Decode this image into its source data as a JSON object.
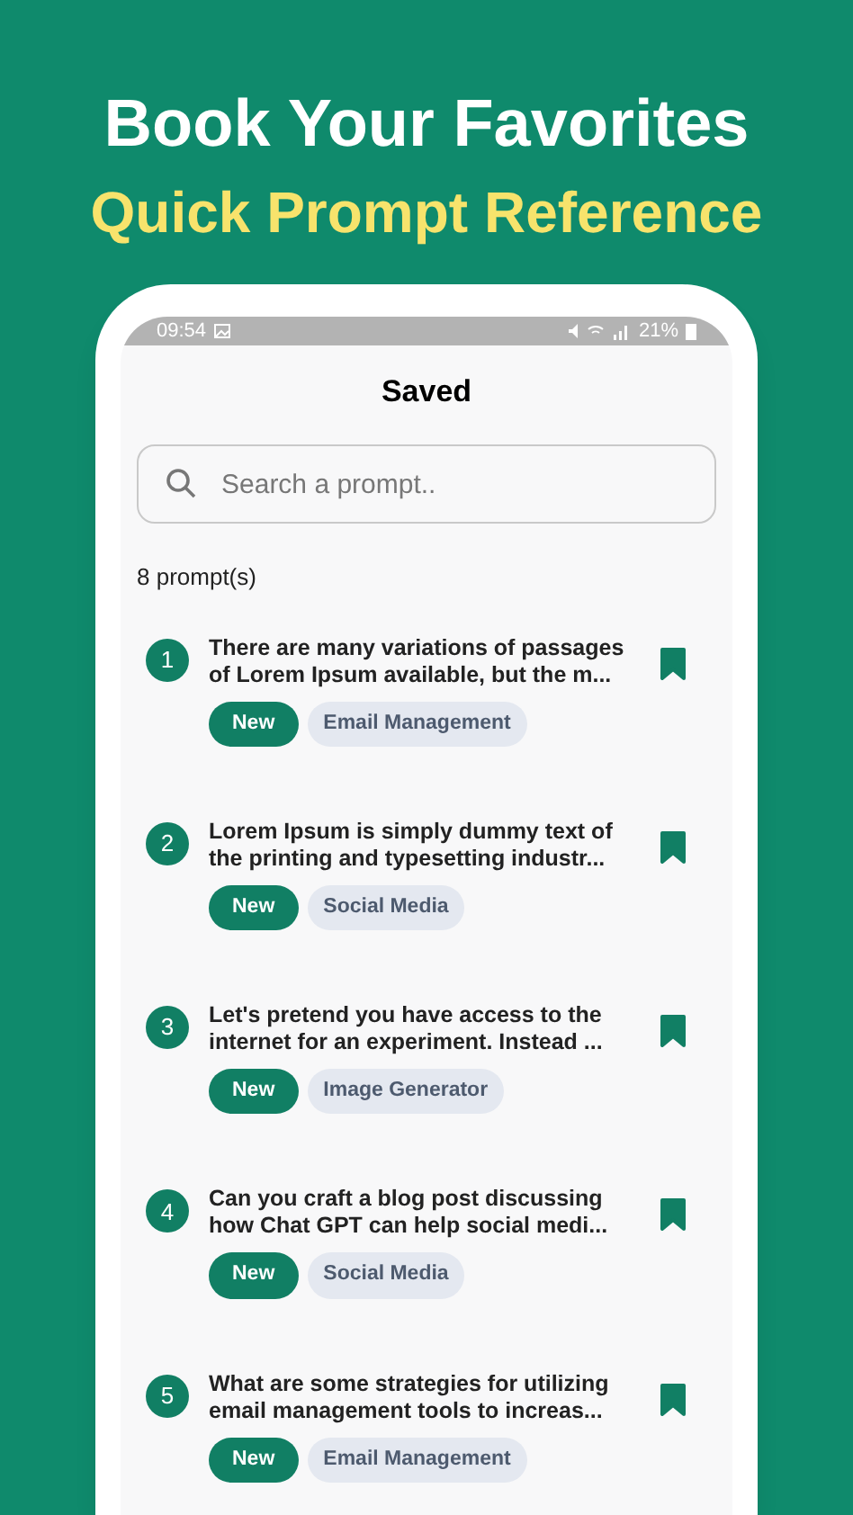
{
  "headline": "Book Your Favorites",
  "subheadline": "Quick Prompt Reference",
  "status_bar": {
    "time": "09:54",
    "battery": "21%"
  },
  "screen_title": "Saved",
  "search": {
    "placeholder": "Search a prompt.."
  },
  "count": "8 prompt(s)",
  "prompts": [
    {
      "number": "1",
      "text": "There are many variations of passages of Lorem Ipsum available, but the m...",
      "badge": "New",
      "category": "Email Management",
      "saved": true
    },
    {
      "number": "2",
      "text": "Lorem Ipsum is simply dummy text of the printing and typesetting industr...",
      "badge": "New",
      "category": "Social Media",
      "saved": true
    },
    {
      "number": "3",
      "text": "Let's pretend you have access to the internet for an experiment. Instead ...",
      "badge": "New",
      "category": "Image Generator",
      "saved": true
    },
    {
      "number": "4",
      "text": "Can you craft a blog post discussing how Chat GPT can help social medi...",
      "badge": "New",
      "category": "Social Media",
      "saved": true
    },
    {
      "number": "5",
      "text": "What are some strategies for utilizing email management tools to increas...",
      "badge": "New",
      "category": "Email Management",
      "saved": true
    }
  ]
}
